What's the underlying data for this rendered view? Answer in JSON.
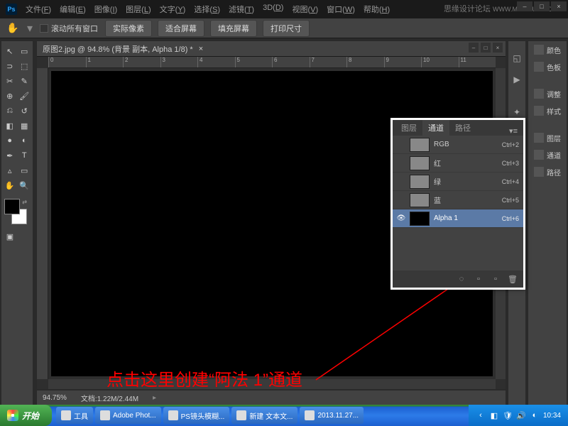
{
  "app": {
    "logo": "Ps"
  },
  "watermark": {
    "text": "思缘设计论坛",
    "url": "WWW.MISSYUAN.COM"
  },
  "menus": [
    {
      "label": "文件",
      "key": "F"
    },
    {
      "label": "编辑",
      "key": "E"
    },
    {
      "label": "图像",
      "key": "I"
    },
    {
      "label": "图层",
      "key": "L"
    },
    {
      "label": "文字",
      "key": "Y"
    },
    {
      "label": "选择",
      "key": "S"
    },
    {
      "label": "滤镜",
      "key": "T"
    },
    {
      "label": "3D",
      "key": "D"
    },
    {
      "label": "视图",
      "key": "V"
    },
    {
      "label": "窗口",
      "key": "W"
    },
    {
      "label": "帮助",
      "key": "H"
    }
  ],
  "options": {
    "scroll_all": "滚动所有窗口",
    "buttons": [
      "实际像素",
      "适合屏幕",
      "填充屏幕",
      "打印尺寸"
    ]
  },
  "document": {
    "tab_title": "原图2.jpg @ 94.8% (背景 副本, Alpha 1/8) *",
    "zoom": "94.75%",
    "doc_size": "文档:1.22M/2.44M"
  },
  "ruler_marks": [
    "0",
    "1",
    "2",
    "3",
    "4",
    "5",
    "6",
    "7",
    "8",
    "9",
    "10",
    "11"
  ],
  "channels_panel": {
    "tabs": [
      "图层",
      "通道",
      "路径"
    ],
    "rows": [
      {
        "name": "RGB",
        "shortcut": "Ctrl+2",
        "eye": false,
        "thumb": "gray"
      },
      {
        "name": "红",
        "shortcut": "Ctrl+3",
        "eye": false,
        "thumb": "gray"
      },
      {
        "name": "绿",
        "shortcut": "Ctrl+4",
        "eye": false,
        "thumb": "gray"
      },
      {
        "name": "蓝",
        "shortcut": "Ctrl+5",
        "eye": false,
        "thumb": "gray"
      },
      {
        "name": "Alpha 1",
        "shortcut": "Ctrl+6",
        "eye": true,
        "thumb": "black",
        "selected": true
      }
    ]
  },
  "right_dock": [
    "颜色",
    "色板",
    "调整",
    "样式",
    "图层",
    "通道",
    "路径"
  ],
  "annotation": "点击这里创建“阿法 1”通道",
  "taskbar": {
    "start": "开始",
    "items": [
      "工具",
      "Adobe Phot...",
      "PS镜头模糊...",
      "新建 文本文...",
      "2013.11.27..."
    ],
    "time": "10:34"
  }
}
